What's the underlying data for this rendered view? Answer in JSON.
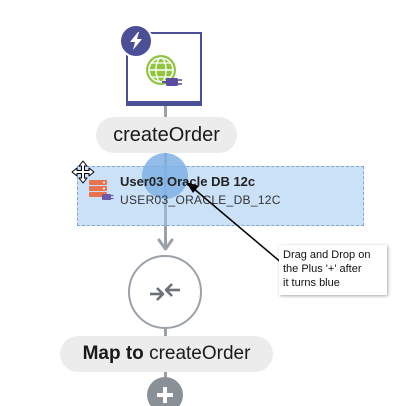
{
  "trigger": {
    "badge_icon": "lightning-bolt-icon",
    "connection_icon": "globe-plug-icon",
    "label": "createOrder"
  },
  "drop_target": {
    "connection_name": "User03 Oracle DB 12c",
    "connection_id": "USER03_ORACLE_DB_12C",
    "icon": "database-icon",
    "cursor_icon": "move-cursor-icon"
  },
  "map_node": {
    "icon": "map-arrows-icon",
    "label_bold": "Map to",
    "label_rest": "createOrder"
  },
  "add_button": {
    "icon": "plus-icon"
  },
  "annotation": {
    "lines": [
      "Drag and Drop on",
      "the Plus '+' after",
      "it turns blue"
    ]
  },
  "colors": {
    "trigger_border": "#4b4f96",
    "flow_line": "#9aa1a9",
    "pill_bg": "#ececec",
    "drag_highlight": "#a0c8f0",
    "drop_plus": "#7fb2e5",
    "add_button": "#8a9098",
    "db_icon": "#e8734f"
  }
}
